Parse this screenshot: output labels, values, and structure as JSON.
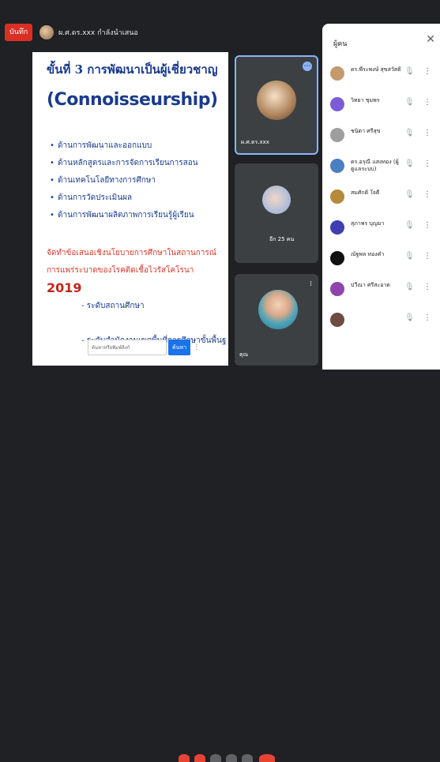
{
  "window": {
    "record_label": "บันทึก",
    "presenter_name": "ผ.ศ.ดร.xxx กำลังนำเสนอ"
  },
  "slide": {
    "title": "ขั้นที่ 3 การพัฒนาเป็นผู้เชี่ยวชาญ",
    "subtitle": "(Connoisseurship)",
    "bullets": [
      "ด้านการพัฒนาและออกแบบ",
      "ด้านหลักสูตรและการจัดการเรียนการสอน",
      "ด้านเทคโนโลยีทางการศึกษา",
      "ด้านการวัดประเมินผล",
      "ด้านการพัฒนาผลิตภาพการเรียนรู้ผู้เรียน"
    ],
    "red_text": "จัดทำข้อเสนอเชิงนโยบายการศึกษาในสถานการณ์การแพร่ระบาดของโรคติดเชื้อไวรัสโคโรนา",
    "year": "2019",
    "subitems": [
      "- ระดับสถานศึกษา",
      "- ระดับสำนักงานเขตพื้นที่การศึกษาขั้นพื้นฐาน"
    ],
    "input_placeholder": "ค้นหาหรือพิมพ์ลิงก์",
    "input_button": "ค้นหา"
  },
  "tiles": [
    {
      "name": "ผ.ศ.ดร.xxx"
    },
    {
      "name": "อีก 25 คน"
    },
    {
      "name": "คุณ"
    }
  ],
  "panel": {
    "title": "ผู้คน",
    "participants": [
      {
        "name": "ดร.พีระพงษ์ สุขสวัสดิ์",
        "color": "#c49a6c"
      },
      {
        "name": "วิทยา ชุมพร",
        "color": "#7b5cd6"
      },
      {
        "name": "ชนิตา ศรีสุข",
        "color": "#9e9e9e"
      },
      {
        "name": "ดร.อรุณี แสงทอง (ผู้ดูแลระบบ)",
        "color": "#4a7fc1"
      },
      {
        "name": "สมศักดิ์ ใจดี",
        "color": "#b58a3a"
      },
      {
        "name": "สุภาพร บุญมา",
        "color": "#3f3fb0"
      },
      {
        "name": "ณัฐพล ทองคำ",
        "color": "#111111"
      },
      {
        "name": "ปวีณา ศรีสะอาด",
        "color": "#8e44ad"
      },
      {
        "name": "",
        "color": "#6d4c41"
      }
    ]
  }
}
